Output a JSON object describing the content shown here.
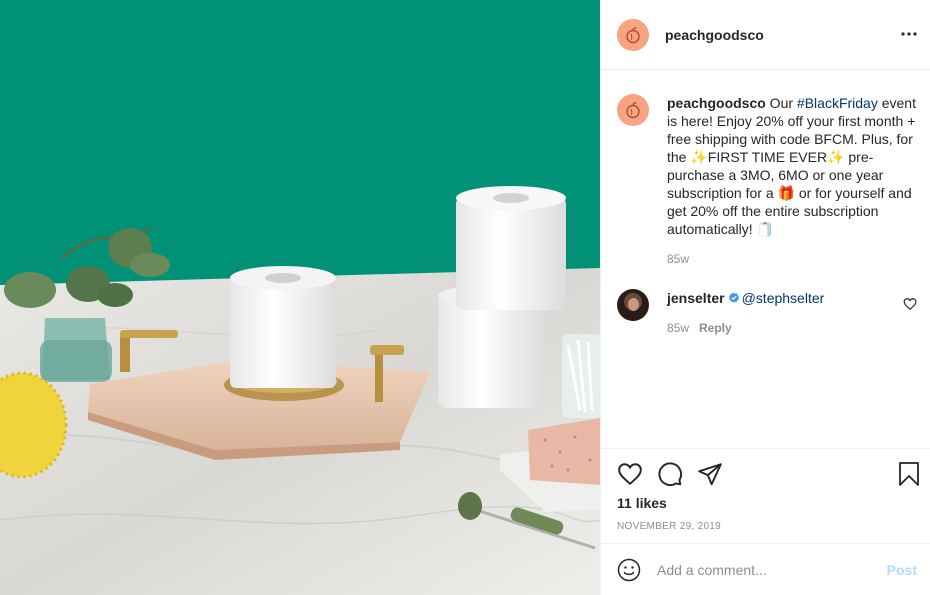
{
  "post_author": {
    "username": "peachgoodsco",
    "avatar_icon": "peach-logo-icon",
    "brand_color": "#f6a482"
  },
  "menu_icon": "more-options-icon",
  "caption": {
    "username": "peachgoodsco",
    "text_1": " Our ",
    "hashtag": "#BlackFriday",
    "text_2": " event is here! Enjoy 20% off your first month + free shipping with code BFCM. Plus, for the ✨FIRST TIME EVER✨ pre-purchase a 3MO, 6MO or one year subscription for a 🎁 or for yourself and get 20% off the entire subscription automatically! 🧻",
    "time": "85w"
  },
  "comment": {
    "username": "jenselter",
    "mention": "@stephselter",
    "time": "85w",
    "reply_label": "Reply",
    "verified_color": "#3897f0"
  },
  "actions": {
    "icons": [
      "heart-icon",
      "comment-icon",
      "share-icon",
      "bookmark-icon"
    ],
    "likes": "11 likes",
    "date": "NOVEMBER 29, 2019"
  },
  "add_comment": {
    "placeholder": "Add a comment...",
    "post_label": "Post",
    "post_color": "#b3dbff"
  }
}
